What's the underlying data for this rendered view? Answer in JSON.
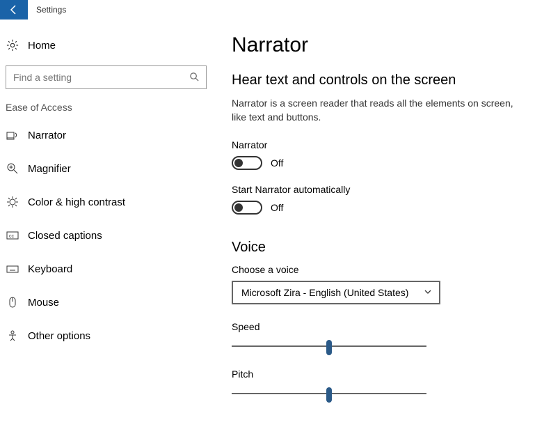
{
  "titlebar": {
    "title": "Settings"
  },
  "sidebar": {
    "home": "Home",
    "search_placeholder": "Find a setting",
    "category": "Ease of Access",
    "items": [
      {
        "label": "Narrator"
      },
      {
        "label": "Magnifier"
      },
      {
        "label": "Color & high contrast"
      },
      {
        "label": "Closed captions"
      },
      {
        "label": "Keyboard"
      },
      {
        "label": "Mouse"
      },
      {
        "label": "Other options"
      }
    ]
  },
  "main": {
    "title": "Narrator",
    "section1_title": "Hear text and controls on the screen",
    "description": "Narrator is a screen reader that reads all the elements on screen, like text and buttons.",
    "toggle1": {
      "label": "Narrator",
      "state": "Off"
    },
    "toggle2": {
      "label": "Start Narrator automatically",
      "state": "Off"
    },
    "voice_title": "Voice",
    "voice_choose": "Choose a voice",
    "voice_selected": "Microsoft Zira - English (United States)",
    "speed_label": "Speed",
    "pitch_label": "Pitch"
  }
}
